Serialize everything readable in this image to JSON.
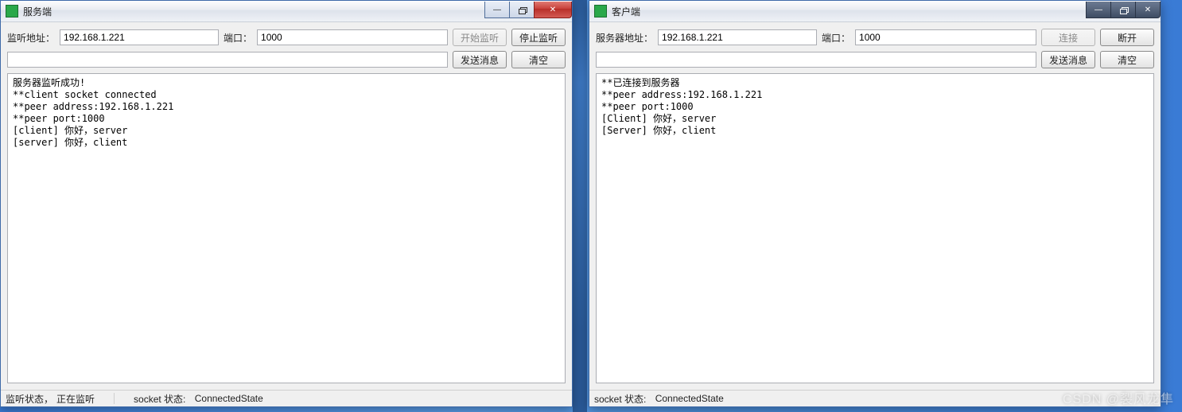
{
  "server": {
    "title": "服务端",
    "labels": {
      "listen_addr": "监听地址：",
      "port": "端口：",
      "start_listen": "开始监听",
      "stop_listen": "停止监听",
      "send_msg": "发送消息",
      "clear": "清空"
    },
    "values": {
      "addr": "192.168.1.221",
      "port": "1000",
      "msg": ""
    },
    "log": "服务器监听成功!\n**client socket connected\n**peer address:192.168.1.221\n**peer port:1000\n[client] 你好，server\n[server] 你好，client",
    "status": {
      "listen_label": "监听状态，",
      "listen_value": "正在监听",
      "socket_label": "socket 状态:",
      "socket_value": "ConnectedState"
    }
  },
  "client": {
    "title": "客户端",
    "labels": {
      "server_addr": "服务器地址：",
      "port": "端口：",
      "connect": "连接",
      "disconnect": "断开",
      "send_msg": "发送消息",
      "clear": "清空"
    },
    "values": {
      "addr": "192.168.1.221",
      "port": "1000",
      "msg": ""
    },
    "log": "**已连接到服务器\n**peer address:192.168.1.221\n**peer port:1000\n[Client] 你好，server\n[Server] 你好，client",
    "status": {
      "socket_label": "socket 状态:",
      "socket_value": "ConnectedState"
    }
  },
  "watermark": "CSDN @裂风龙隼"
}
